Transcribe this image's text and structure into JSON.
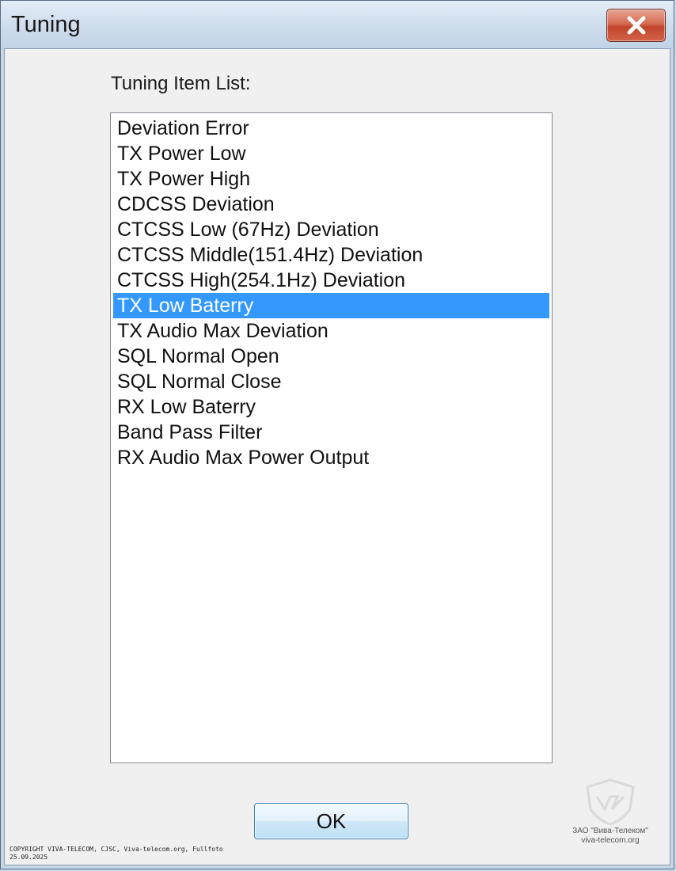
{
  "window": {
    "title": "Tuning",
    "close_icon": "close-icon"
  },
  "list": {
    "label": "Tuning Item List:",
    "items": [
      {
        "label": "Deviation Error",
        "selected": false
      },
      {
        "label": "TX Power Low",
        "selected": false
      },
      {
        "label": "TX Power High",
        "selected": false
      },
      {
        "label": "CDCSS Deviation",
        "selected": false
      },
      {
        "label": "CTCSS Low (67Hz) Deviation",
        "selected": false
      },
      {
        "label": "CTCSS Middle(151.4Hz) Deviation",
        "selected": false
      },
      {
        "label": "CTCSS High(254.1Hz) Deviation",
        "selected": false
      },
      {
        "label": "TX Low Baterry",
        "selected": true
      },
      {
        "label": "TX Audio Max Deviation",
        "selected": false
      },
      {
        "label": "SQL Normal Open",
        "selected": false
      },
      {
        "label": "SQL Normal Close",
        "selected": false
      },
      {
        "label": "RX Low Baterry",
        "selected": false
      },
      {
        "label": "Band Pass Filter",
        "selected": false
      },
      {
        "label": "RX Audio Max Power Output",
        "selected": false
      }
    ]
  },
  "buttons": {
    "ok_label": "OK"
  },
  "footer": {
    "copyright_line1": "COPYRIGHT VIVA-TELECOM, CJSC, Viva-telecom.org, Fullfoto",
    "copyright_line2": "25.09.2025",
    "watermark_line1": "ЗАО \"Вива-Телеком\"",
    "watermark_line2": "viva-telecom.org"
  },
  "colors": {
    "selection": "#3399ff",
    "close_button": "#c94a30"
  }
}
